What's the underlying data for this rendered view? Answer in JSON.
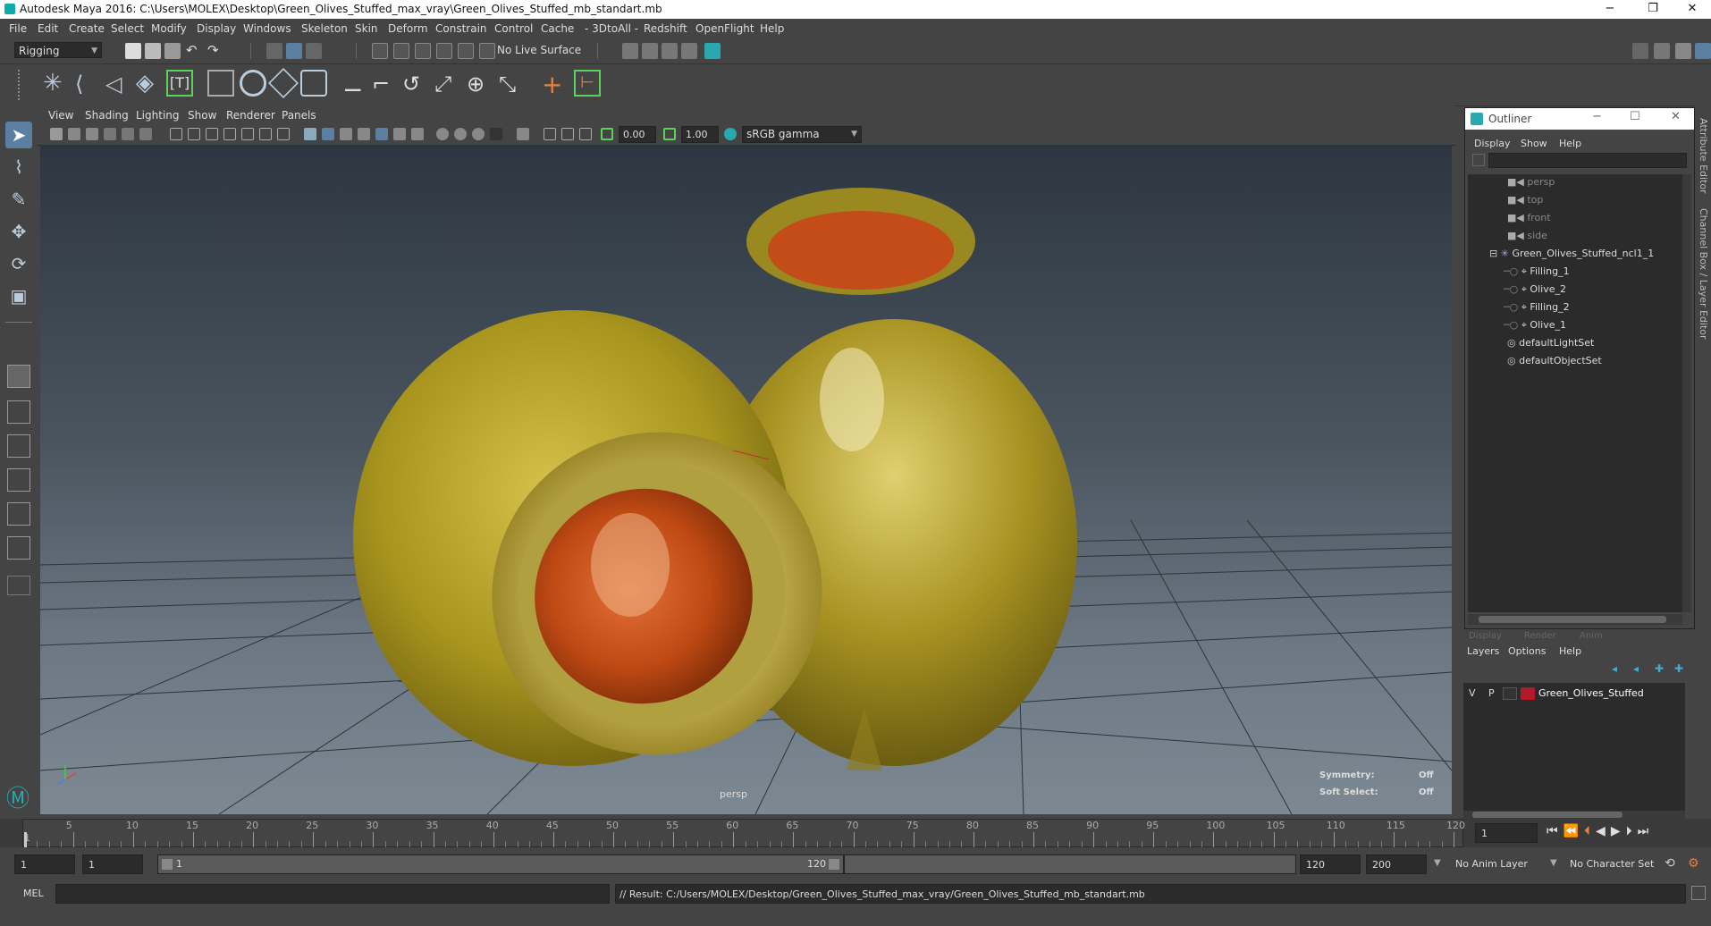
{
  "window": {
    "title": "Autodesk Maya 2016: C:\\Users\\MOLEX\\Desktop\\Green_Olives_Stuffed_max_vray\\Green_Olives_Stuffed_mb_standart.mb",
    "minimize": "−",
    "restore": "❐",
    "close": "✕"
  },
  "menubar": [
    "File",
    "Edit",
    "Create",
    "Select",
    "Modify",
    "Display",
    "Windows",
    "Skeleton",
    "Skin",
    "Deform",
    "Constrain",
    "Control",
    "Cache",
    "- 3DtoAll -",
    "Redshift",
    "OpenFlight",
    "Help"
  ],
  "statusline": {
    "menuset": "Rigging",
    "live_surface": "No Live Surface"
  },
  "viewport_menu": [
    "View",
    "Shading",
    "Lighting",
    "Show",
    "Renderer",
    "Panels"
  ],
  "viewport_toolbar": {
    "exposure": "0.00",
    "gamma": "1.00",
    "colorspace": "sRGB gamma"
  },
  "viewport": {
    "camera_label": "persp",
    "symmetry_label": "Symmetry:",
    "symmetry_value": "Off",
    "soft_select_label": "Soft Select:",
    "soft_select_value": "Off"
  },
  "outliner": {
    "title": "Outliner",
    "menu": [
      "Display",
      "Show",
      "Help"
    ],
    "nodes": [
      {
        "label": "persp",
        "indent": 1,
        "icon": "camera-icon",
        "dim": true
      },
      {
        "label": "top",
        "indent": 1,
        "icon": "camera-icon",
        "dim": true
      },
      {
        "label": "front",
        "indent": 1,
        "icon": "camera-icon",
        "dim": true
      },
      {
        "label": "side",
        "indent": 1,
        "icon": "camera-icon",
        "dim": true
      },
      {
        "label": "Green_Olives_Stuffed_ncl1_1",
        "indent": 1,
        "icon": "group-icon",
        "dim": false,
        "expanded": true
      },
      {
        "label": "Filling_1",
        "indent": 2,
        "icon": "mesh-icon",
        "dim": false
      },
      {
        "label": "Olive_2",
        "indent": 2,
        "icon": "mesh-icon",
        "dim": false
      },
      {
        "label": "Filling_2",
        "indent": 2,
        "icon": "mesh-icon",
        "dim": false
      },
      {
        "label": "Olive_1",
        "indent": 2,
        "icon": "mesh-icon",
        "dim": false
      },
      {
        "label": "defaultLightSet",
        "indent": 1,
        "icon": "set-icon",
        "dim": false
      },
      {
        "label": "defaultObjectSet",
        "indent": 1,
        "icon": "set-icon",
        "dim": false
      }
    ]
  },
  "layer_editor": {
    "tabs": [
      "Display",
      "Render",
      "Anim"
    ],
    "menu": [
      "Layers",
      "Options",
      "Help"
    ],
    "layer": {
      "v": "V",
      "p": "P",
      "name": "Green_Olives_Stuffed",
      "color": "#b01a2a"
    }
  },
  "side_tabs": [
    "Attribute Editor",
    "Channel Box / Layer Editor"
  ],
  "timeline": {
    "ticks": [
      "1",
      "5",
      "10",
      "15",
      "20",
      "25",
      "30",
      "35",
      "40",
      "45",
      "50",
      "55",
      "60",
      "65",
      "70",
      "75",
      "80",
      "85",
      "90",
      "95",
      "100",
      "105",
      "110",
      "115",
      "120"
    ],
    "current_frame": "1"
  },
  "range": {
    "start": "1",
    "playback_start": "1",
    "slider_start": "1",
    "slider_end": "120",
    "playback_end": "120",
    "end": "200",
    "anim_layer": "No Anim Layer",
    "character_set": "No Character Set"
  },
  "command": {
    "lang": "MEL",
    "result": "// Result: C:/Users/MOLEX/Desktop/Green_Olives_Stuffed_max_vray/Green_Olives_Stuffed_mb_standart.mb"
  },
  "colors": {
    "olive": "#b8a52a",
    "filling": "#c8501a",
    "accent_cyan": "#2aa8b0",
    "shelf_green": "#5bd35b"
  }
}
